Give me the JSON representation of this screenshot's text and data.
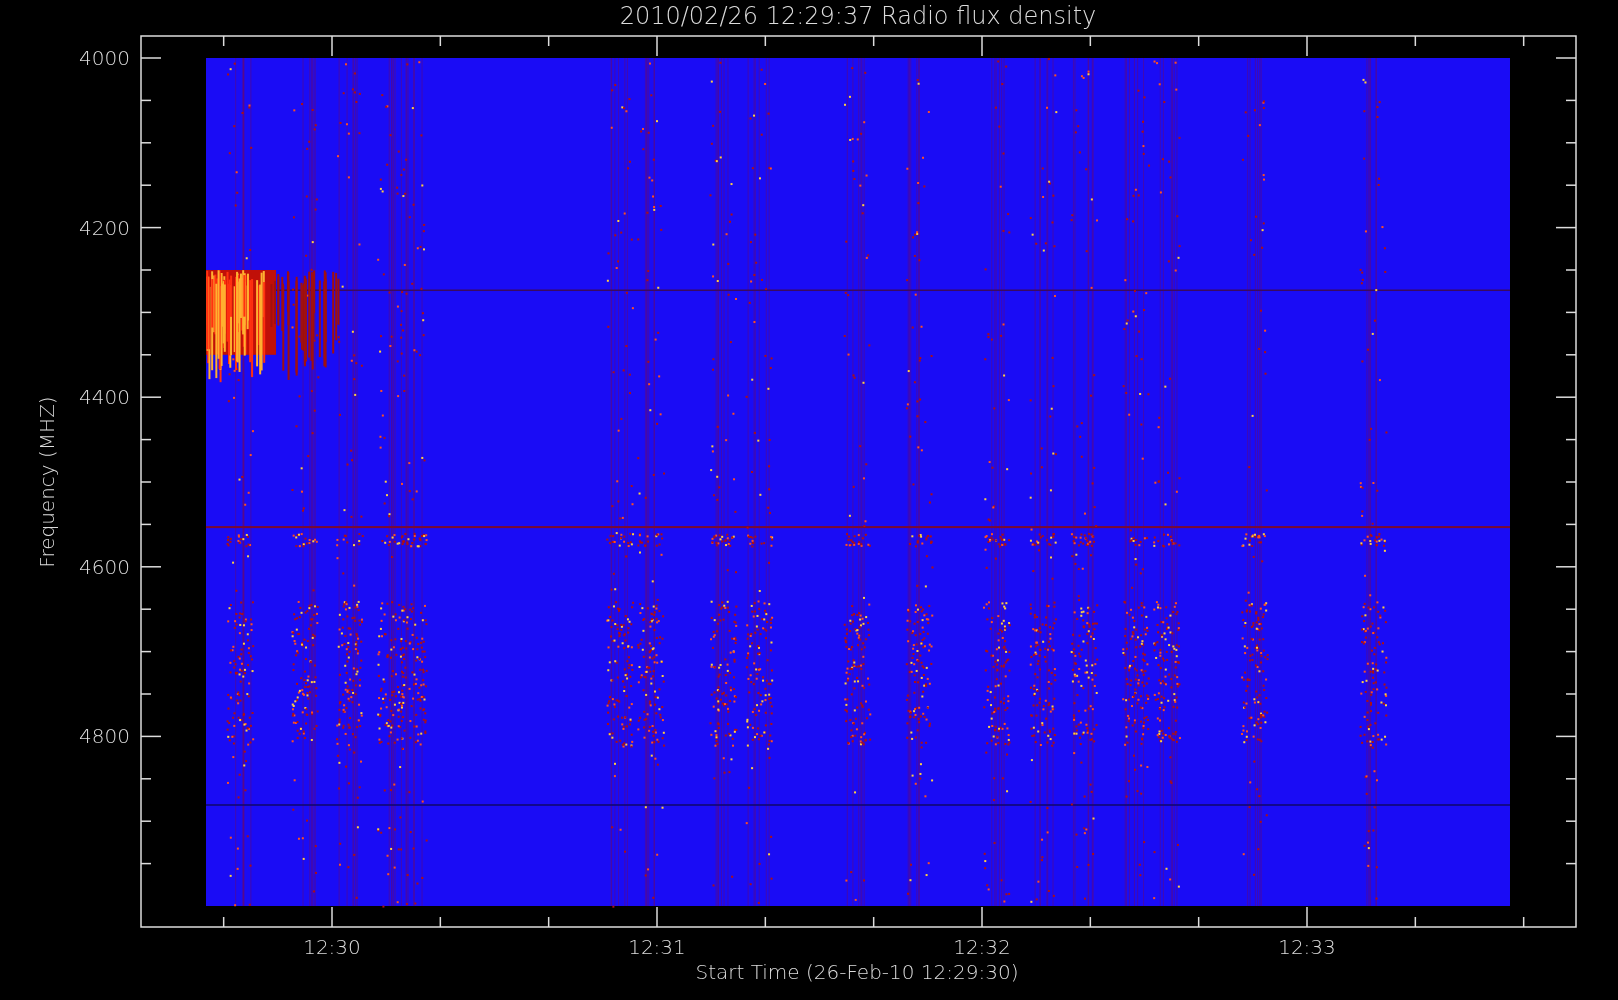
{
  "plot": {
    "title": "2010/02/26 12:29:37 Radio flux density",
    "xlabel": "Start Time (26-Feb-10 12:29:30)",
    "ylabel": "Frequency (MHZ)",
    "xticks": [
      "12:30",
      "12:31",
      "12:32",
      "12:33"
    ],
    "yticks": [
      "4000",
      "4200",
      "4400",
      "4600",
      "4800"
    ]
  }
}
